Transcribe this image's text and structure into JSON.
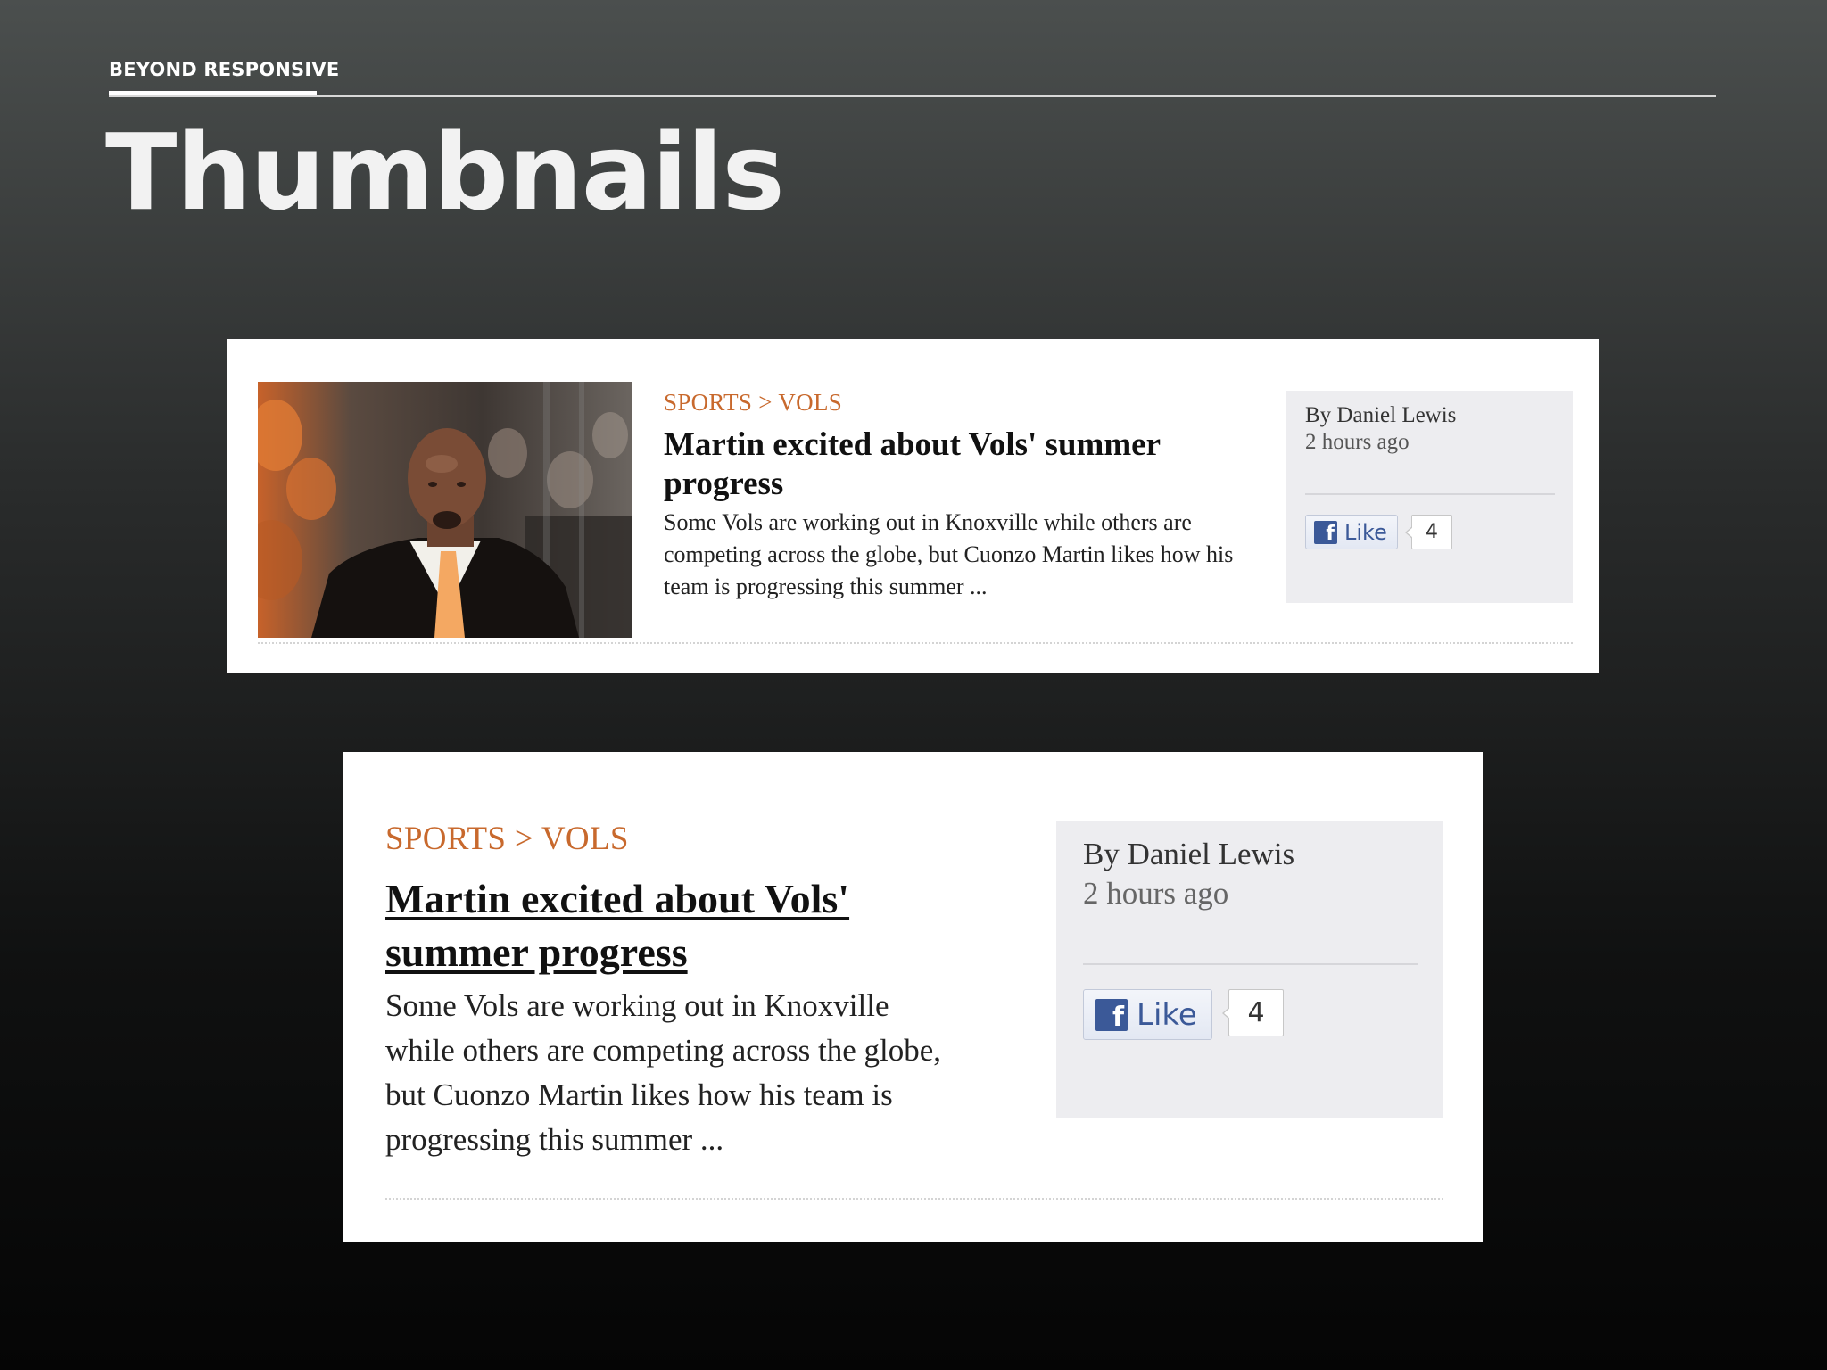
{
  "slide": {
    "section_label": "BEYOND RESPONSIVE",
    "title": "Thumbnails"
  },
  "articles": [
    {
      "has_thumbnail": true,
      "breadcrumb": "SPORTS > VOLS",
      "headline": "Martin excited about Vols' summer progress",
      "summary": "Some Vols are working out in Knoxville while others are competing across the globe, but Cuonzo Martin likes how his team is progressing this summer ...",
      "byline": "By Daniel Lewis",
      "time": "2 hours ago",
      "like_label": "Like",
      "like_icon": "facebook-icon",
      "like_count": "4"
    },
    {
      "has_thumbnail": false,
      "breadcrumb": "SPORTS > VOLS",
      "headline": "Martin excited about Vols' summer progress",
      "summary": "Some Vols are working out in Knoxville while others are competing across the globe, but Cuonzo Martin likes how his team is progressing this summer ...",
      "byline": "By Daniel Lewis",
      "time": "2 hours ago",
      "like_label": "Like",
      "like_icon": "facebook-icon",
      "like_count": "4"
    }
  ],
  "colors": {
    "breadcrumb": "#c8692d",
    "facebook_blue": "#3b5998",
    "meta_box_bg": "#ededf0"
  }
}
